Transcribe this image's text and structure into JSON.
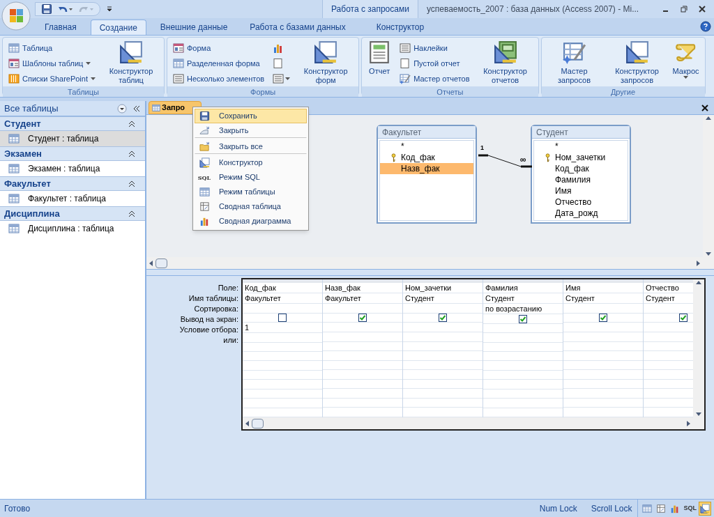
{
  "title_bar": {
    "contextual_label": "Работа с запросами",
    "title": "успеваемость_2007 : база данных (Access 2007) - Mi..."
  },
  "ribbon_tabs": [
    {
      "label": "Главная",
      "selected": false,
      "kind": "main"
    },
    {
      "label": "Создание",
      "selected": true,
      "kind": "main"
    },
    {
      "label": "Внешние данные",
      "selected": false,
      "kind": "main"
    },
    {
      "label": "Работа с базами данных",
      "selected": false,
      "kind": "main"
    },
    {
      "label": "Конструктор",
      "selected": false,
      "kind": "contextual"
    }
  ],
  "ribbon_groups": [
    {
      "title": "Таблицы",
      "columns": [
        [
          {
            "kind": "small",
            "label": "Таблица",
            "dropdown": false
          },
          {
            "kind": "small",
            "label": "Шаблоны таблиц",
            "dropdown": true
          },
          {
            "kind": "small",
            "label": "Списки SharePoint",
            "dropdown": true
          }
        ],
        [
          {
            "kind": "large",
            "label": "Конструктор таблиц",
            "dropdown": false
          }
        ]
      ]
    },
    {
      "title": "Формы",
      "columns": [
        [
          {
            "kind": "small",
            "label": "Форма",
            "dropdown": false
          },
          {
            "kind": "small",
            "label": "Разделенная форма",
            "dropdown": false
          },
          {
            "kind": "small",
            "label": "Несколько элементов",
            "dropdown": false
          }
        ],
        [
          {
            "kind": "icon",
            "dropdown": false
          },
          {
            "kind": "icon",
            "dropdown": false
          },
          {
            "kind": "icon",
            "dropdown": true
          }
        ],
        [
          {
            "kind": "large",
            "label": "Конструктор форм",
            "dropdown": false
          }
        ]
      ]
    },
    {
      "title": "Отчеты",
      "columns": [
        [
          {
            "kind": "large",
            "label": "Отчет",
            "dropdown": false
          }
        ],
        [
          {
            "kind": "small",
            "label": "Наклейки",
            "dropdown": false
          },
          {
            "kind": "small",
            "label": "Пустой отчет",
            "dropdown": false
          },
          {
            "kind": "small",
            "label": "Мастер отчетов",
            "dropdown": false
          }
        ],
        [
          {
            "kind": "large",
            "label": "Конструктор отчетов",
            "dropdown": false
          }
        ]
      ]
    },
    {
      "title": "Другие",
      "columns": [
        [
          {
            "kind": "large",
            "label": "Мастер запросов",
            "dropdown": false
          }
        ],
        [
          {
            "kind": "large",
            "label": "Конструктор запросов",
            "dropdown": false
          }
        ],
        [
          {
            "kind": "large",
            "label": "Макрос",
            "dropdown": true
          }
        ]
      ]
    }
  ],
  "nav_pane": {
    "title": "Все таблицы",
    "groups": [
      {
        "name": "Студент",
        "expanded": true,
        "items": [
          {
            "label": "Студент : таблица",
            "selected": true
          }
        ]
      },
      {
        "name": "Экзамен",
        "expanded": true,
        "items": [
          {
            "label": "Экзамен : таблица",
            "selected": false
          }
        ]
      },
      {
        "name": "Факультет",
        "expanded": true,
        "items": [
          {
            "label": "Факультет : таблица",
            "selected": false
          }
        ]
      },
      {
        "name": "Дисциплина",
        "expanded": true,
        "items": [
          {
            "label": "Дисциплина : таблица",
            "selected": false
          }
        ]
      }
    ]
  },
  "document_tab": {
    "label": "Запро"
  },
  "context_menu": {
    "items": [
      {
        "label": "Сохранить",
        "selected": true,
        "separator_after": false
      },
      {
        "label": "Закрыть",
        "selected": false,
        "separator_after": true
      },
      {
        "label": "Закрыть все",
        "selected": false,
        "separator_after": true
      },
      {
        "label": "Конструктор",
        "selected": false,
        "separator_after": false
      },
      {
        "label": "Режим SQL",
        "icon_text": "SQL",
        "selected": false,
        "separator_after": false
      },
      {
        "label": "Режим таблицы",
        "selected": false,
        "separator_after": false
      },
      {
        "label": "Сводная таблица",
        "selected": false,
        "separator_after": false
      },
      {
        "label": "Сводная диаграмма",
        "selected": false,
        "separator_after": false
      }
    ]
  },
  "query_tables": [
    {
      "title": "Факультет",
      "fields": [
        {
          "name": "*",
          "primary_key": false,
          "selected": false
        },
        {
          "name": "Код_фак",
          "primary_key": true,
          "selected": false
        },
        {
          "name": "Назв_фак",
          "primary_key": false,
          "selected": true
        }
      ]
    },
    {
      "title": "Студент",
      "fields": [
        {
          "name": "*",
          "primary_key": false,
          "selected": false
        },
        {
          "name": "Ном_зачетки",
          "primary_key": true,
          "selected": false
        },
        {
          "name": "Код_фак",
          "primary_key": false,
          "selected": false
        },
        {
          "name": "Фамилия",
          "primary_key": false,
          "selected": false
        },
        {
          "name": "Имя",
          "primary_key": false,
          "selected": false
        },
        {
          "name": "Отчество",
          "primary_key": false,
          "selected": false
        },
        {
          "name": "Дата_рожд",
          "primary_key": false,
          "selected": false
        }
      ]
    }
  ],
  "relationship": {
    "one_label": "1",
    "many_label": "∞"
  },
  "design_grid": {
    "row_labels": [
      "Поле:",
      "Имя таблицы:",
      "Сортировка:",
      "Вывод на экран:",
      "Условие отбора:",
      "или:"
    ],
    "columns": [
      {
        "field": "Код_фак",
        "table": "Факультет",
        "show": false,
        "criteria": "1"
      },
      {
        "field": "Назв_фак",
        "table": "Факультет",
        "show": true
      },
      {
        "field": "Ном_зачетки",
        "table": "Студент",
        "show": true
      },
      {
        "field": "Фамилия",
        "table": "Студент",
        "sort": "по возрастанию",
        "show": true
      },
      {
        "field": "Имя",
        "table": "Студент",
        "show": true
      },
      {
        "field": "Отчество",
        "table": "Студент",
        "show": true
      }
    ]
  },
  "status_bar": {
    "text": "Готово",
    "indicators": [
      "Num Lock",
      "Scroll Lock"
    ],
    "view_buttons": [
      {
        "kind": "datasheet",
        "selected": false
      },
      {
        "kind": "pivot-table",
        "selected": false
      },
      {
        "kind": "pivot-chart",
        "selected": false
      },
      {
        "kind": "sql",
        "label": "SQL",
        "selected": false
      },
      {
        "kind": "design",
        "selected": true
      }
    ]
  }
}
